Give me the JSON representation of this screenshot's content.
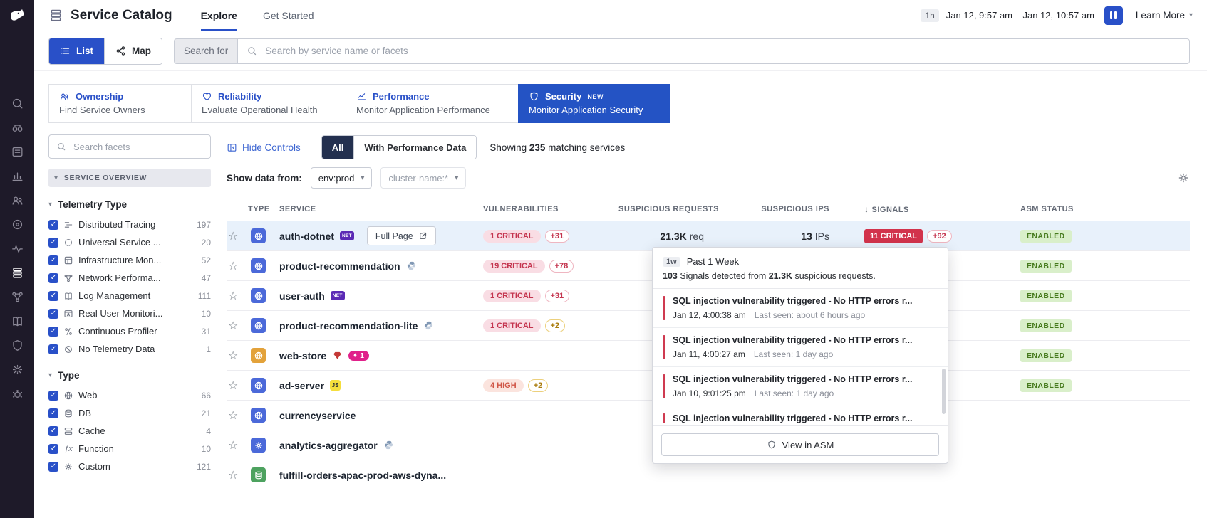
{
  "sidebar": {
    "icons": [
      {
        "name": "search"
      },
      {
        "name": "watchdog"
      },
      {
        "name": "dashboards"
      },
      {
        "name": "metrics"
      },
      {
        "name": "people"
      },
      {
        "name": "synthetics"
      },
      {
        "name": "apm"
      },
      {
        "name": "service-catalog",
        "active": true
      },
      {
        "name": "network"
      },
      {
        "name": "logs"
      },
      {
        "name": "security-shield"
      },
      {
        "name": "settings"
      },
      {
        "name": "bug"
      }
    ]
  },
  "header": {
    "app_title": "Service Catalog",
    "tabs": [
      {
        "label": "Explore",
        "active": true
      },
      {
        "label": "Get Started",
        "active": false
      }
    ],
    "time": {
      "duration": "1h",
      "range": "Jan 12, 9:57 am – Jan 12, 10:57 am"
    },
    "learn_more": "Learn More"
  },
  "toolbar": {
    "view_toggle": [
      {
        "label": "List",
        "icon": "list",
        "active": true
      },
      {
        "label": "Map",
        "icon": "map",
        "active": false
      }
    ],
    "search_prefix": "Search for",
    "search_placeholder": "Search by service name or facets"
  },
  "category_tabs": [
    {
      "label": "Ownership",
      "sub": "Find Service Owners",
      "icon": "people",
      "active": false
    },
    {
      "label": "Reliability",
      "sub": "Evaluate Operational Health",
      "icon": "heart",
      "active": false
    },
    {
      "label": "Performance",
      "sub": "Monitor Application Performance",
      "icon": "perf",
      "active": false
    },
    {
      "label": "Security",
      "badge": "NEW",
      "sub": "Monitor Application Security",
      "icon": "security-shield",
      "active": true
    }
  ],
  "facets": {
    "search_placeholder": "Search facets",
    "overview": "SERVICE OVERVIEW",
    "groups": [
      {
        "title": "Telemetry Type",
        "items": [
          {
            "icon": "tracing",
            "label": "Distributed Tracing",
            "count": "197",
            "checked": true
          },
          {
            "icon": "service",
            "label": "Universal Service ...",
            "count": "20",
            "checked": true
          },
          {
            "icon": "infra",
            "label": "Infrastructure Mon...",
            "count": "52",
            "checked": true
          },
          {
            "icon": "network",
            "label": "Network Performa...",
            "count": "47",
            "checked": true
          },
          {
            "icon": "logs",
            "label": "Log Management",
            "count": "111",
            "checked": true
          },
          {
            "icon": "rum",
            "label": "Real User Monitori...",
            "count": "10",
            "checked": true
          },
          {
            "icon": "profiler",
            "label": "Continuous Profiler",
            "count": "31",
            "checked": true
          },
          {
            "icon": "no-telemetry",
            "label": "No Telemetry Data",
            "count": "1",
            "checked": true
          }
        ]
      },
      {
        "title": "Type",
        "items": [
          {
            "icon": "globe",
            "label": "Web",
            "count": "66",
            "checked": true
          },
          {
            "icon": "db",
            "label": "DB",
            "count": "21",
            "checked": true
          },
          {
            "icon": "cache",
            "label": "Cache",
            "count": "4",
            "checked": true
          },
          {
            "icon": "function",
            "label": "Function",
            "count": "10",
            "checked": true
          },
          {
            "icon": "settings",
            "label": "Custom",
            "count": "121",
            "checked": true
          }
        ]
      }
    ]
  },
  "controls": {
    "hide_controls": "Hide Controls",
    "filter_toggle": [
      {
        "label": "All",
        "active": true
      },
      {
        "label": "With Performance Data",
        "active": false
      }
    ],
    "showing": {
      "prefix": "Showing",
      "count": "235",
      "suffix": "matching services"
    },
    "show_data_from": "Show data from:",
    "filters": [
      {
        "value": "env:prod",
        "muted": false
      },
      {
        "value": "cluster-name:*",
        "muted": true
      }
    ]
  },
  "table": {
    "columns": [
      "TYPE",
      "SERVICE",
      "VULNERABILITIES",
      "SUSPICIOUS REQUESTS",
      "SUSPICIOUS IPS",
      "SIGNALS",
      "ASM STATUS"
    ],
    "sort_column": "SIGNALS",
    "rows": [
      {
        "type": "web",
        "name": "auth-dotnet",
        "lang": "dotnet",
        "full_page": "Full Page",
        "vuln": {
          "label": "1 CRITICAL",
          "severity": "critical",
          "plus": "+31",
          "plus_style": "red"
        },
        "requests": {
          "value": "21.3K",
          "unit": "req"
        },
        "ips": {
          "value": "13",
          "unit": "IPs"
        },
        "signals": {
          "label": "11 CRITICAL",
          "plus": "+92"
        },
        "status": "ENABLED",
        "highlighted": true
      },
      {
        "type": "web",
        "name": "product-recommendation",
        "lang": "python",
        "vuln": {
          "label": "19 CRITICAL",
          "severity": "critical",
          "plus": "+78",
          "plus_style": "red"
        },
        "status": "ENABLED"
      },
      {
        "type": "web",
        "name": "user-auth",
        "lang": "dotnet",
        "vuln": {
          "label": "1 CRITICAL",
          "severity": "critical",
          "plus": "+31",
          "plus_style": "red"
        },
        "status": "ENABLED"
      },
      {
        "type": "web",
        "name": "product-recommendation-lite",
        "lang": "python",
        "vuln": {
          "label": "1 CRITICAL",
          "severity": "critical",
          "plus": "+2",
          "plus_style": "yellow"
        },
        "status": "ENABLED"
      },
      {
        "type": "web-amber",
        "name": "web-store",
        "lang": "ruby",
        "flame_count": "1",
        "status": "ENABLED"
      },
      {
        "type": "web",
        "name": "ad-server",
        "lang": "js",
        "vuln": {
          "label": "4 HIGH",
          "severity": "high",
          "plus": "+2",
          "plus_style": "yellow"
        },
        "status": "ENABLED"
      },
      {
        "type": "web",
        "name": "currencyservice"
      },
      {
        "type": "custom",
        "name": "analytics-aggregator",
        "lang": "python"
      },
      {
        "type": "db",
        "name": "fulfill-orders-apac-prod-aws-dyna..."
      }
    ]
  },
  "popover": {
    "period_badge": "1w",
    "period_label": "Past 1 Week",
    "summary": {
      "count": "103",
      "text_mid": "Signals detected from",
      "highlight": "21.3K",
      "text_end": "suspicious requests."
    },
    "signals": [
      {
        "title": "SQL injection vulnerability triggered - No HTTP errors r...",
        "time": "Jan 12, 4:00:38 am",
        "last_seen": "Last seen: about 6 hours ago"
      },
      {
        "title": "SQL injection vulnerability triggered - No HTTP errors r...",
        "time": "Jan 11, 4:00:27 am",
        "last_seen": "Last seen: 1 day ago"
      },
      {
        "title": "SQL injection vulnerability triggered - No HTTP errors r...",
        "time": "Jan 10, 9:01:25 pm",
        "last_seen": "Last seen: 1 day ago"
      },
      {
        "title": "SQL injection vulnerability triggered - No HTTP errors r...",
        "partial": true
      }
    ],
    "view_button": "View in ASM"
  }
}
